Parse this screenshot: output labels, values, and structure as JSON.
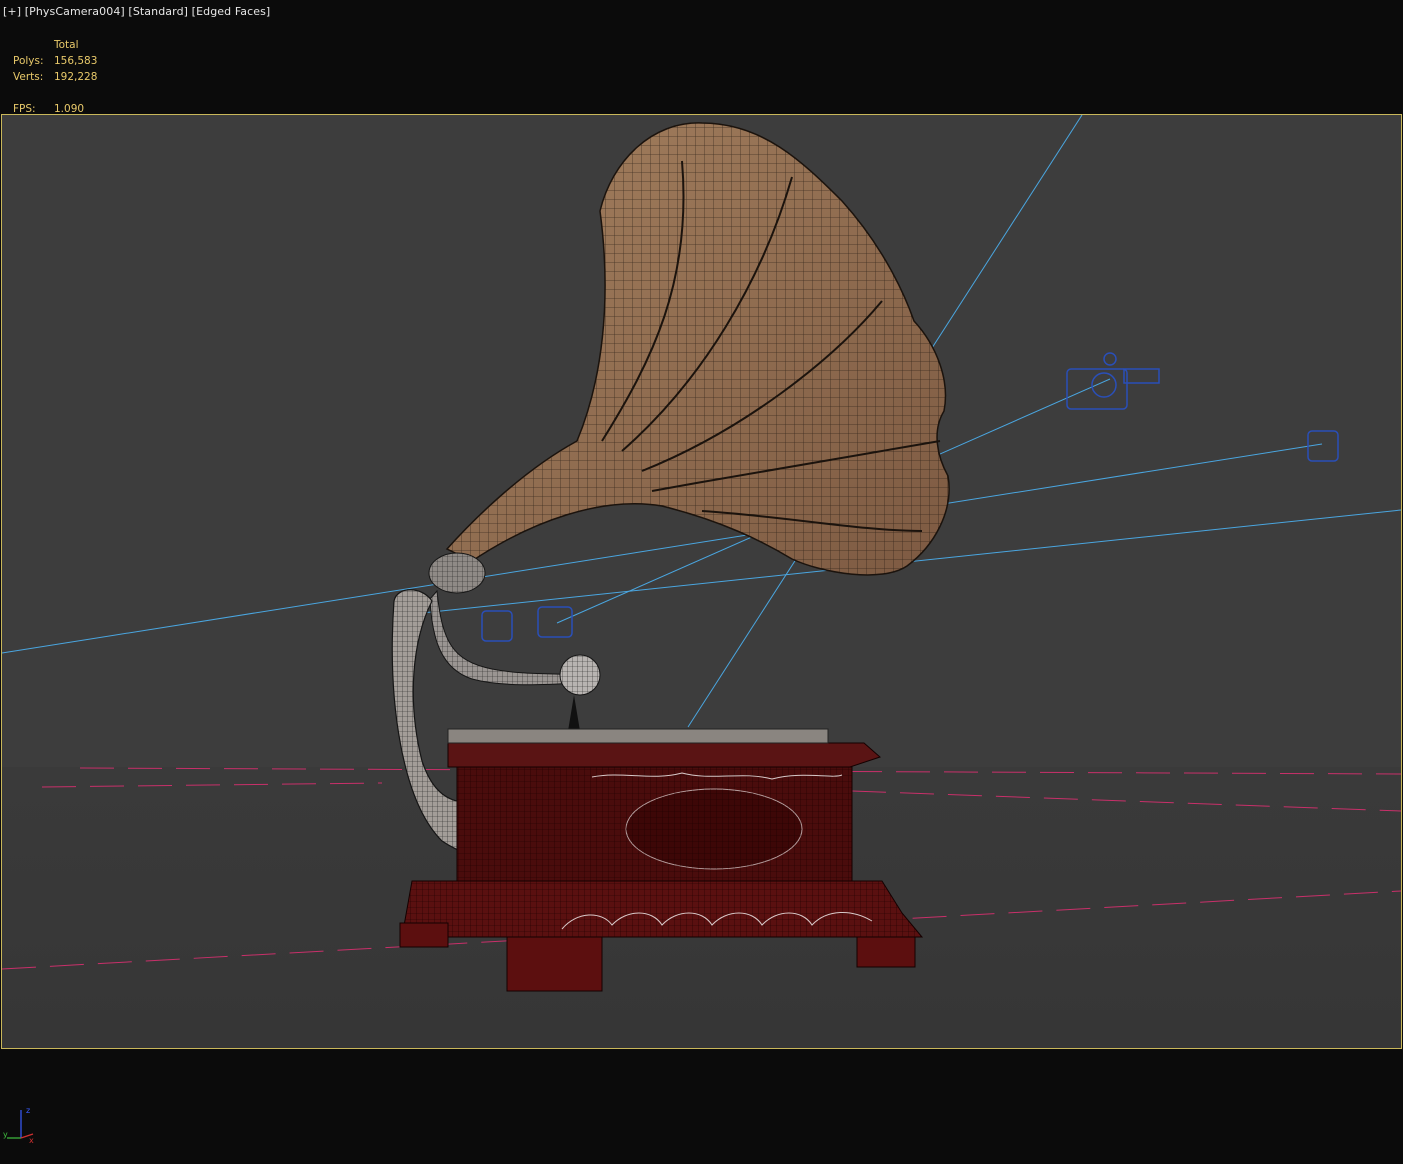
{
  "viewport": {
    "label": {
      "menu": "[+]",
      "camera": "[PhysCamera004]",
      "shading": "[Standard]",
      "mode": "[Edged Faces]"
    },
    "stats": {
      "header": "Total",
      "polys_label": "Polys:",
      "polys_value": "156,583",
      "verts_label": "Verts:",
      "verts_value": "192,228",
      "fps_label": "FPS:",
      "fps_value": "1.090"
    }
  },
  "colors": {
    "viewport_bg": "#3d3d3d",
    "viewport_border": "#c9b75a",
    "stats_text": "#e8c96a",
    "camera_lines": "#4aa6e0",
    "camera_icon": "#2a4fb8",
    "horizon_dash": "#c8306a",
    "horn": "#9b7355",
    "cabinet": "#4a0c0c"
  },
  "axis": {
    "x": "x",
    "y": "y",
    "z": "z"
  },
  "icons": [
    "camera-icon",
    "camera-target-icon",
    "axis-gizmo-icon"
  ]
}
